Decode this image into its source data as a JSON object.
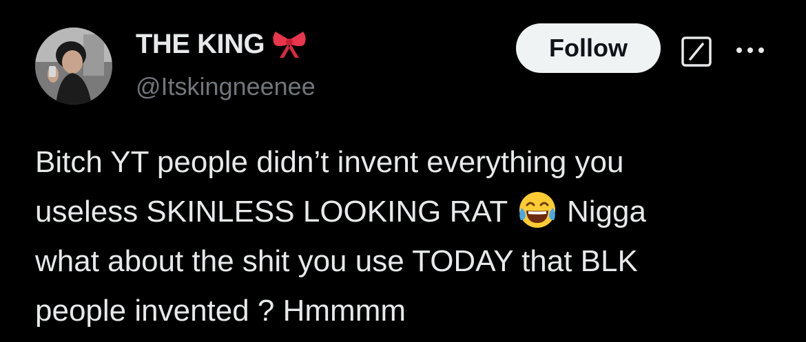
{
  "author": {
    "display_name": "THE KING",
    "name_emoji": "ribbon-bow",
    "handle": "@Itskingneenee",
    "avatar": "user-avatar"
  },
  "actions": {
    "follow_label": "Follow",
    "grok_icon": "grok-icon",
    "more_icon": "more-options-icon"
  },
  "tweet": {
    "line1": "Bitch YT people didn’t invent everything you",
    "line2_before": "useless SKINLESS LOOKING RAT",
    "line2_emoji": "face-with-tears-of-joy",
    "line2_after": "Nigga",
    "line3": "what about the shit you use TODAY that BLK",
    "line4": "people invented ? Hmmmm"
  },
  "colors": {
    "background": "#000000",
    "text": "#e7e9ea",
    "secondary": "#71767b",
    "follow_bg": "#eff3f4",
    "follow_text": "#0f1419",
    "bow": "#e8364d"
  }
}
